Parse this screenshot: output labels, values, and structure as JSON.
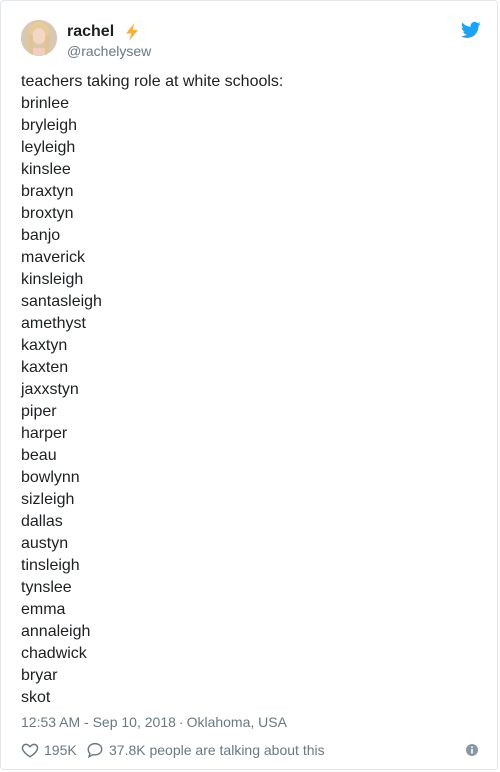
{
  "author": {
    "display_name": "rachel",
    "handle": "@rachelysew"
  },
  "tweet": {
    "lines": [
      "teachers taking role at white schools:",
      "brinlee",
      "bryleigh",
      "leyleigh",
      "kinslee",
      "braxtyn",
      "broxtyn",
      "banjo",
      "maverick",
      "kinsleigh",
      "santasleigh",
      "amethyst",
      "kaxtyn",
      "kaxten",
      "jaxxstyn",
      "piper",
      "harper",
      "beau",
      "bowlynn",
      "sizleigh",
      "dallas",
      "austyn",
      "tinsleigh",
      "tynslee",
      "emma",
      "annaleigh",
      "chadwick",
      "bryar",
      "skot"
    ]
  },
  "meta": {
    "time": "12:53 AM - Sep 10, 2018",
    "separator": "·",
    "location": "Oklahoma, USA"
  },
  "actions": {
    "likes": "195K",
    "conversation": "37.8K people are talking about this"
  },
  "colors": {
    "text": "#1c2022",
    "muted": "#697882",
    "twitter_blue": "#1da1f2",
    "bolt": "#ffac33",
    "border": "#e1e8ed"
  },
  "icons": {
    "bolt": "high-voltage-icon",
    "bird": "twitter-bird-icon",
    "like": "heart-icon",
    "reply": "speech-bubble-icon",
    "info": "info-icon"
  }
}
